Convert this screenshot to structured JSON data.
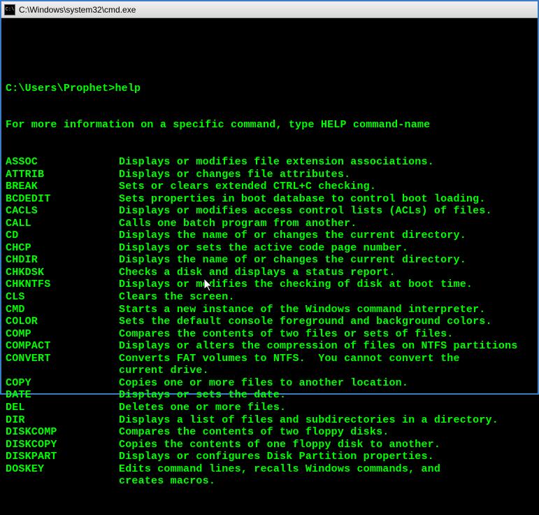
{
  "window": {
    "title": "C:\\Windows\\system32\\cmd.exe",
    "icon_label": "C:\\"
  },
  "prompt": {
    "path": "C:\\Users\\Prophet>",
    "command": "help"
  },
  "intro": "For more information on a specific command, type HELP command-name",
  "commands": [
    {
      "name": "ASSOC",
      "desc": "Displays or modifies file extension associations."
    },
    {
      "name": "ATTRIB",
      "desc": "Displays or changes file attributes."
    },
    {
      "name": "BREAK",
      "desc": "Sets or clears extended CTRL+C checking."
    },
    {
      "name": "BCDEDIT",
      "desc": "Sets properties in boot database to control boot loading."
    },
    {
      "name": "CACLS",
      "desc": "Displays or modifies access control lists (ACLs) of files."
    },
    {
      "name": "CALL",
      "desc": "Calls one batch program from another."
    },
    {
      "name": "CD",
      "desc": "Displays the name of or changes the current directory."
    },
    {
      "name": "CHCP",
      "desc": "Displays or sets the active code page number."
    },
    {
      "name": "CHDIR",
      "desc": "Displays the name of or changes the current directory."
    },
    {
      "name": "CHKDSK",
      "desc": "Checks a disk and displays a status report."
    },
    {
      "name": "CHKNTFS",
      "desc": "Displays or modifies the checking of disk at boot time."
    },
    {
      "name": "CLS",
      "desc": "Clears the screen."
    },
    {
      "name": "CMD",
      "desc": "Starts a new instance of the Windows command interpreter."
    },
    {
      "name": "COLOR",
      "desc": "Sets the default console foreground and background colors."
    },
    {
      "name": "COMP",
      "desc": "Compares the contents of two files or sets of files."
    },
    {
      "name": "COMPACT",
      "desc": "Displays or alters the compression of files on NTFS partitions"
    },
    {
      "name": "CONVERT",
      "desc": "Converts FAT volumes to NTFS.  You cannot convert the\ncurrent drive."
    },
    {
      "name": "COPY",
      "desc": "Copies one or more files to another location."
    },
    {
      "name": "DATE",
      "desc": "Displays or sets the date."
    },
    {
      "name": "DEL",
      "desc": "Deletes one or more files."
    },
    {
      "name": "DIR",
      "desc": "Displays a list of files and subdirectories in a directory."
    },
    {
      "name": "DISKCOMP",
      "desc": "Compares the contents of two floppy disks."
    },
    {
      "name": "DISKCOPY",
      "desc": "Copies the contents of one floppy disk to another."
    },
    {
      "name": "DISKPART",
      "desc": "Displays or configures Disk Partition properties."
    },
    {
      "name": "DOSKEY",
      "desc": "Edits command lines, recalls Windows commands, and\ncreates macros."
    }
  ]
}
